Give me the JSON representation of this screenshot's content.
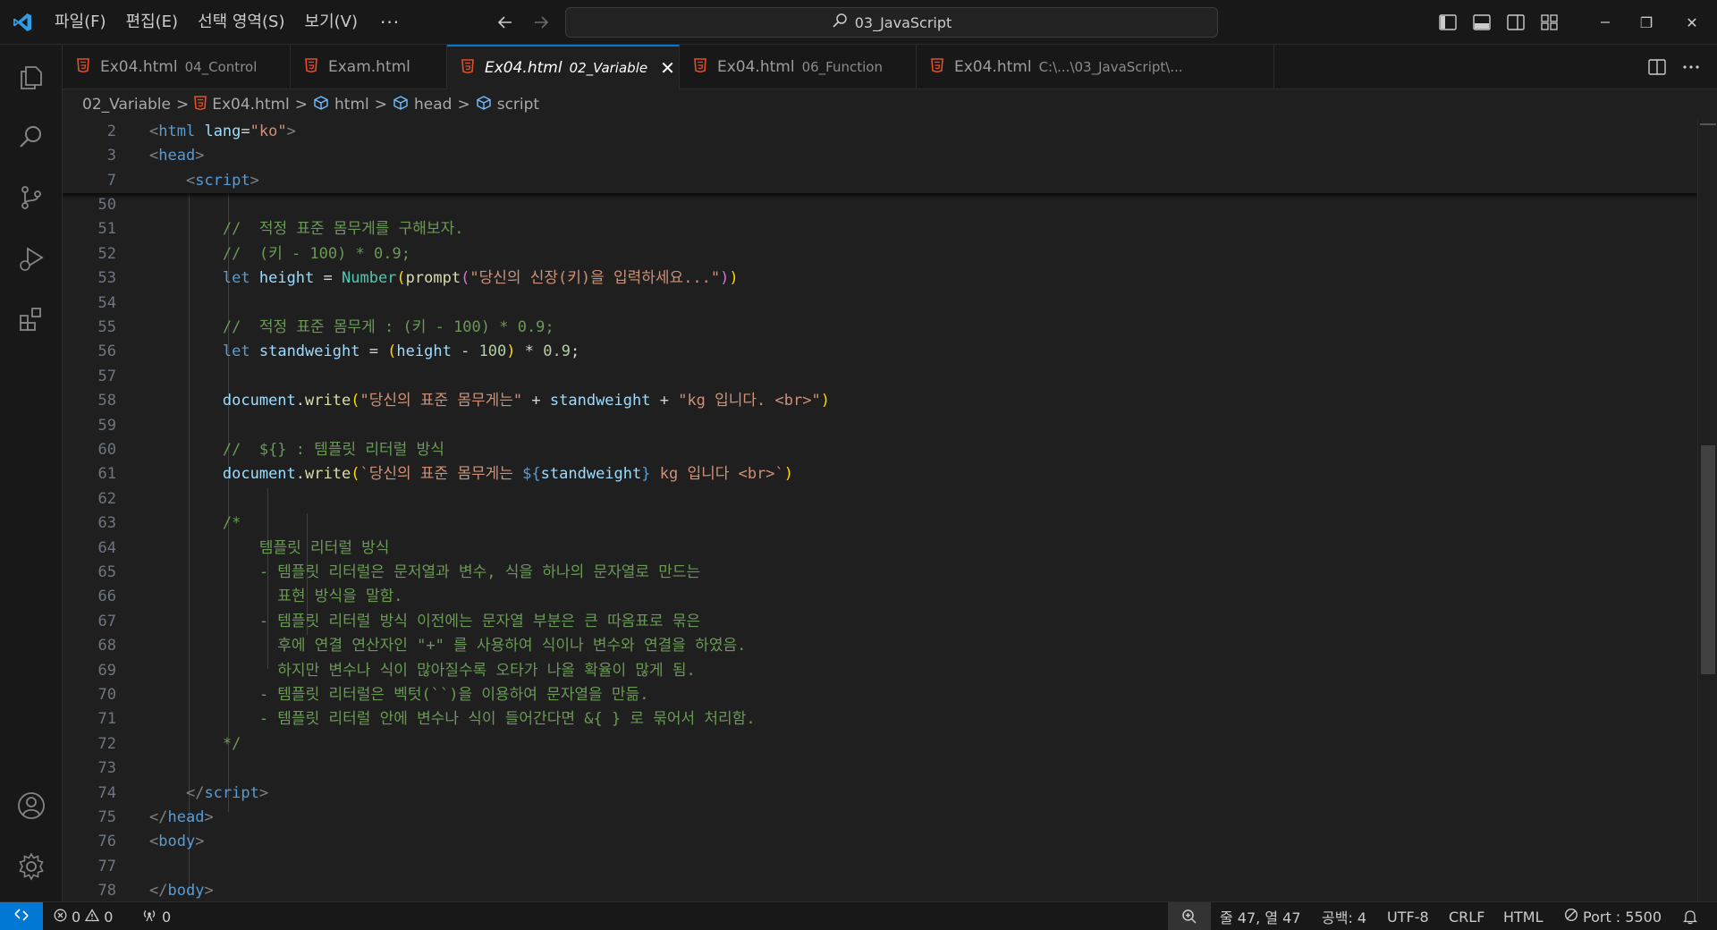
{
  "titlebar": {
    "menus": [
      "파일(F)",
      "편집(E)",
      "선택 영역(S)",
      "보기(V)"
    ],
    "more": "···",
    "search_text": "03_JavaScript",
    "window_restore": "❐",
    "window_close": "✕"
  },
  "tabs": [
    {
      "name": "Ex04.html",
      "desc": "04_Control"
    },
    {
      "name": "Exam.html",
      "desc": ""
    },
    {
      "name": "Ex04.html",
      "desc": "02_Variable",
      "active": true
    },
    {
      "name": "Ex04.html",
      "desc": "06_Function"
    },
    {
      "name": "Ex04.html",
      "desc": "C:\\...\\03_JavaScript\\..."
    }
  ],
  "tab_close_glyph": "✕",
  "breadcrumb": {
    "folder": "02_Variable",
    "file": "Ex04.html",
    "sym1": "html",
    "sym2": "head",
    "sym3": "script",
    "sep": ">"
  },
  "editor": {
    "sticky_lines": [
      {
        "n": "2",
        "tokens": [
          [
            "t-punct",
            "<"
          ],
          [
            "t-tag",
            "html"
          ],
          [
            "t-op",
            " "
          ],
          [
            "t-attr",
            "lang"
          ],
          [
            "t-op",
            "="
          ],
          [
            "t-str",
            "\"ko\""
          ],
          [
            "t-punct",
            ">"
          ]
        ]
      },
      {
        "n": "3",
        "tokens": [
          [
            "t-punct",
            "<"
          ],
          [
            "t-tag",
            "head"
          ],
          [
            "t-punct",
            ">"
          ]
        ]
      },
      {
        "n": "7",
        "tokens": [
          [
            "t-op",
            "    "
          ],
          [
            "t-punct",
            "<"
          ],
          [
            "t-tag",
            "script"
          ],
          [
            "t-punct",
            ">"
          ]
        ]
      }
    ],
    "lines": [
      {
        "n": "50",
        "tokens": []
      },
      {
        "n": "51",
        "tokens": [
          [
            "t-op",
            "        "
          ],
          [
            "t-com",
            "//  적정 표준 몸무게를 구해보자."
          ]
        ]
      },
      {
        "n": "52",
        "tokens": [
          [
            "t-op",
            "        "
          ],
          [
            "t-com",
            "//  (키 - 100) * 0.9;"
          ]
        ]
      },
      {
        "n": "53",
        "tokens": [
          [
            "t-op",
            "        "
          ],
          [
            "t-kw",
            "let"
          ],
          [
            "t-op",
            " "
          ],
          [
            "t-var",
            "height"
          ],
          [
            "t-op",
            " = "
          ],
          [
            "t-cls",
            "Number"
          ],
          [
            "t-b1",
            "("
          ],
          [
            "t-fn",
            "prompt"
          ],
          [
            "t-b2",
            "("
          ],
          [
            "t-str",
            "\"당신의 신장(키)을 입력하세요...\""
          ],
          [
            "t-b2",
            ")"
          ],
          [
            "t-b1",
            ")"
          ]
        ]
      },
      {
        "n": "54",
        "tokens": []
      },
      {
        "n": "55",
        "tokens": [
          [
            "t-op",
            "        "
          ],
          [
            "t-com",
            "//  적정 표준 몸무게 : (키 - 100) * 0.9;"
          ]
        ]
      },
      {
        "n": "56",
        "tokens": [
          [
            "t-op",
            "        "
          ],
          [
            "t-kw",
            "let"
          ],
          [
            "t-op",
            " "
          ],
          [
            "t-var",
            "standweight"
          ],
          [
            "t-op",
            " = "
          ],
          [
            "t-b1",
            "("
          ],
          [
            "t-var",
            "height"
          ],
          [
            "t-op",
            " - "
          ],
          [
            "t-num",
            "100"
          ],
          [
            "t-b1",
            ")"
          ],
          [
            "t-op",
            " * "
          ],
          [
            "t-num",
            "0.9"
          ],
          [
            "t-op",
            ";"
          ]
        ]
      },
      {
        "n": "57",
        "tokens": []
      },
      {
        "n": "58",
        "tokens": [
          [
            "t-op",
            "        "
          ],
          [
            "t-var",
            "document"
          ],
          [
            "t-op",
            "."
          ],
          [
            "t-fn",
            "write"
          ],
          [
            "t-b1",
            "("
          ],
          [
            "t-str",
            "\"당신의 표준 몸무게는\""
          ],
          [
            "t-op",
            " + "
          ],
          [
            "t-var",
            "standweight"
          ],
          [
            "t-op",
            " + "
          ],
          [
            "t-str",
            "\"kg 입니다. <br>\""
          ],
          [
            "t-b1",
            ")"
          ]
        ]
      },
      {
        "n": "59",
        "tokens": []
      },
      {
        "n": "60",
        "tokens": [
          [
            "t-op",
            "        "
          ],
          [
            "t-com",
            "//  ${} : 템플릿 리터럴 방식"
          ]
        ]
      },
      {
        "n": "61",
        "tokens": [
          [
            "t-op",
            "        "
          ],
          [
            "t-var",
            "document"
          ],
          [
            "t-op",
            "."
          ],
          [
            "t-fn",
            "write"
          ],
          [
            "t-b1",
            "("
          ],
          [
            "t-str",
            "`당신의 표준 몸무게는 "
          ],
          [
            "t-kw",
            "${"
          ],
          [
            "t-var",
            "standweight"
          ],
          [
            "t-kw",
            "}"
          ],
          [
            "t-str",
            " kg 입니다 <br>`"
          ],
          [
            "t-b1",
            ")"
          ]
        ]
      },
      {
        "n": "62",
        "tokens": []
      },
      {
        "n": "63",
        "tokens": [
          [
            "t-op",
            "        "
          ],
          [
            "t-com",
            "/*"
          ]
        ]
      },
      {
        "n": "64",
        "tokens": [
          [
            "t-com",
            "            템플릿 리터럴 방식"
          ]
        ]
      },
      {
        "n": "65",
        "tokens": [
          [
            "t-com",
            "            - 템플릿 리터럴은 문저열과 변수, 식을 하나의 문자열로 만드는"
          ]
        ]
      },
      {
        "n": "66",
        "tokens": [
          [
            "t-com",
            "              표현 방식을 말함."
          ]
        ]
      },
      {
        "n": "67",
        "tokens": [
          [
            "t-com",
            "            - 템플릿 리터럴 방식 이전에는 문자열 부분은 큰 따옴표로 묶은"
          ]
        ]
      },
      {
        "n": "68",
        "tokens": [
          [
            "t-com",
            "              후에 연결 연산자인 \"+\" 를 사용하여 식이나 변수와 연결을 하였음."
          ]
        ]
      },
      {
        "n": "69",
        "tokens": [
          [
            "t-com",
            "              하지만 변수나 식이 많아질수록 오타가 나올 확율이 많게 됨."
          ]
        ]
      },
      {
        "n": "70",
        "tokens": [
          [
            "t-com",
            "            - 템플릿 리터럴은 벡텃(``)을 이용하여 문자열을 만듦."
          ]
        ]
      },
      {
        "n": "71",
        "tokens": [
          [
            "t-com",
            "            - 템플릿 리터럴 안에 변수나 식이 들어간다면 &{ } 로 묶어서 처리함."
          ]
        ]
      },
      {
        "n": "72",
        "tokens": [
          [
            "t-com",
            "        */"
          ]
        ]
      },
      {
        "n": "73",
        "tokens": []
      },
      {
        "n": "74",
        "tokens": [
          [
            "t-op",
            "    "
          ],
          [
            "t-punct",
            "</"
          ],
          [
            "t-tag",
            "script"
          ],
          [
            "t-punct",
            ">"
          ]
        ]
      },
      {
        "n": "75",
        "tokens": [
          [
            "t-punct",
            "</"
          ],
          [
            "t-tag",
            "head"
          ],
          [
            "t-punct",
            ">"
          ]
        ]
      },
      {
        "n": "76",
        "tokens": [
          [
            "t-punct",
            "<"
          ],
          [
            "t-tag",
            "body"
          ],
          [
            "t-punct",
            ">"
          ]
        ]
      },
      {
        "n": "77",
        "tokens": []
      },
      {
        "n": "78",
        "tokens": [
          [
            "t-punct",
            "</"
          ],
          [
            "t-tag",
            "body"
          ],
          [
            "t-punct",
            ">"
          ]
        ]
      }
    ]
  },
  "statusbar": {
    "errors": "0",
    "warnings": "0",
    "ports": "0",
    "position": "줄 47, 열 47",
    "spaces": "공백: 4",
    "encoding": "UTF-8",
    "eol": "CRLF",
    "language": "HTML",
    "port": "Port : 5500"
  },
  "colors": {
    "accent": "#0078d4",
    "html_icon": "#e44d26",
    "comment": "#6a9955",
    "string": "#ce9178",
    "keyword": "#569cd6"
  }
}
